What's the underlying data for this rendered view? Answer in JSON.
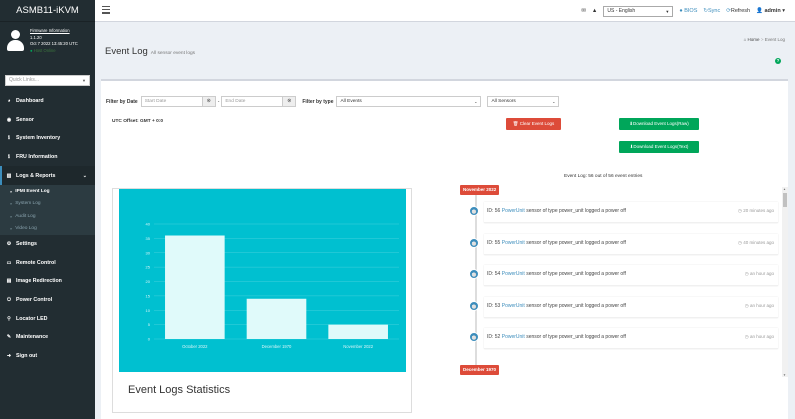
{
  "brand": "ASMB11-iKVM",
  "user": {
    "firmware_link": "Firmware Information",
    "version": "1.1.20",
    "build_date": "Oct 7 2022 13:45:20 UTC",
    "status": "Host Online"
  },
  "quick_links_placeholder": "Quick Links...",
  "menu": [
    {
      "icon": "dashboard-icon",
      "label": "Dashboard"
    },
    {
      "icon": "sensor-icon",
      "label": "Sensor"
    },
    {
      "icon": "info-icon",
      "label": "System Inventory"
    },
    {
      "icon": "info-icon",
      "label": "FRU Information"
    },
    {
      "icon": "chart-icon",
      "label": "Logs & Reports"
    }
  ],
  "submenu": [
    "IPMI Event Log",
    "System Log",
    "Audit Log",
    "Video Log"
  ],
  "menu2": [
    {
      "icon": "gear-icon",
      "label": "Settings"
    },
    {
      "icon": "monitor-icon",
      "label": "Remote Control"
    },
    {
      "icon": "image-icon",
      "label": "Image Redirection"
    },
    {
      "icon": "power-icon",
      "label": "Power Control"
    },
    {
      "icon": "location-icon",
      "label": "Locator LED"
    },
    {
      "icon": "wrench-icon",
      "label": "Maintenance"
    },
    {
      "icon": "signout-icon",
      "label": "Sign out"
    }
  ],
  "topbar": {
    "language": "US - English",
    "bios": "BIOS",
    "sync": "Sync",
    "refresh": "Refresh",
    "user": "admin"
  },
  "page": {
    "title": "Event Log",
    "subtitle": "All sensor event logs",
    "breadcrumb_home": "Home",
    "breadcrumb_current": "Event Log"
  },
  "filters": {
    "date_label": "Filter by Date",
    "start_placeholder": "Start Date",
    "end_placeholder": "End Date",
    "type_label": "Filter by type",
    "type_value": "All Events",
    "sensor_value": "All Sensors",
    "utc_offset": "UTC Offset: GMT + 0:0"
  },
  "buttons": {
    "clear": "Clear Event Logs",
    "download_raw": "Download Event Logs(Raw)",
    "download_text": "Download Event Logs(Text)"
  },
  "summary": "Event Log: 56 out of 56 event entries",
  "chart_data": {
    "type": "bar",
    "title": "Event Logs Statistics",
    "categories": [
      "October 2022",
      "December 1970",
      "November 2022"
    ],
    "values": [
      36,
      14,
      5
    ],
    "ylim": [
      0,
      40
    ],
    "yticks": [
      0,
      5,
      10,
      15,
      20,
      25,
      30,
      35,
      40
    ],
    "bar_color": "#e0fafa",
    "bg_color": "#00c0d0"
  },
  "timeline": {
    "group1": "November 2022",
    "group2": "December 1970",
    "items": [
      {
        "id": "ID: 56",
        "link": "PowerUnit",
        "text": "sensor of type power_unit logged a power off",
        "time": "20 minutes ago"
      },
      {
        "id": "ID: 55",
        "link": "PowerUnit",
        "text": "sensor of type power_unit logged a power off",
        "time": "40 minutes ago"
      },
      {
        "id": "ID: 54",
        "link": "PowerUnit",
        "text": "sensor of type power_unit logged a power off",
        "time": "an hour ago"
      },
      {
        "id": "ID: 53",
        "link": "PowerUnit",
        "text": "sensor of type power_unit logged a power off",
        "time": "an hour ago"
      },
      {
        "id": "ID: 52",
        "link": "PowerUnit",
        "text": "sensor of type power_unit logged a power off",
        "time": "an hour ago"
      }
    ]
  }
}
